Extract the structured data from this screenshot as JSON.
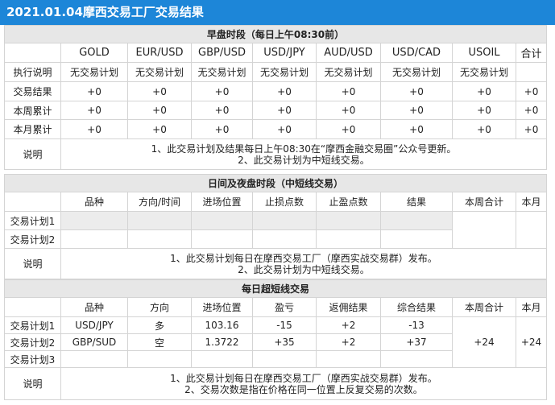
{
  "title": "2021.01.04摩西交易工厂交易结果",
  "s1": {
    "header": "早盘时段（每日上午08:30前）",
    "cols": [
      "GOLD",
      "EUR/USD",
      "GBP/USD",
      "USD/JPY",
      "AUD/USD",
      "USD/CAD",
      "USOIL",
      "合计"
    ],
    "rows": [
      {
        "label": "执行说明",
        "cells": [
          "无交易计划",
          "无交易计划",
          "无交易计划",
          "无交易计划",
          "无交易计划",
          "无交易计划",
          "无交易计划",
          ""
        ]
      },
      {
        "label": "交易结果",
        "cells": [
          "+0",
          "+0",
          "+0",
          "+0",
          "+0",
          "+0",
          "+0",
          "+0"
        ]
      },
      {
        "label": "本周累计",
        "cells": [
          "+0",
          "+0",
          "+0",
          "+0",
          "+0",
          "+0",
          "+0",
          "+0"
        ]
      },
      {
        "label": "本月累计",
        "cells": [
          "+0",
          "+0",
          "+0",
          "+0",
          "+0",
          "+0",
          "+0",
          "+0"
        ]
      }
    ],
    "note_label": "说明",
    "notes": [
      "1、此交易计划及结果每日上午08:30在“摩西金融交易圈”公众号更新。",
      "2、此交易计划为中短线交易。"
    ]
  },
  "s2": {
    "header": "日间及夜盘时段（中短线交易）",
    "cols": [
      "品种",
      "方向/时间",
      "进场位置",
      "止损点数",
      "止盈点数",
      "结果",
      "本周合计",
      "本月"
    ],
    "plans": [
      "交易计划1",
      "交易计划2"
    ],
    "note_label": "说明",
    "notes": [
      "1、此交易计划每日在摩西交易工厂（摩西实战交易群）发布。",
      "2、此交易计划为中短线交易。"
    ]
  },
  "s3": {
    "header": "每日超短线交易",
    "cols": [
      "品种",
      "方向",
      "进场位置",
      "盈亏",
      "返佣结果",
      "综合结果",
      "本周合计",
      "本月"
    ],
    "rows": [
      {
        "label": "交易计划1",
        "cells": [
          "USD/JPY",
          "多",
          "103.16",
          "-15",
          "+2",
          "-13"
        ]
      },
      {
        "label": "交易计划2",
        "cells": [
          "GBP/SUD",
          "空",
          "1.3722",
          "+35",
          "+2",
          "+37"
        ]
      },
      {
        "label": "交易计划3",
        "cells": [
          "",
          "",
          "",
          "",
          "",
          ""
        ]
      }
    ],
    "week_total": "+24",
    "month_total": "+24",
    "note_label": "说明",
    "notes": [
      "1、此交易计划每日在摩西交易工厂（摩西实战交易群）发布。",
      "2、交易次数是指在价格在同一位置上反复交易的次数。"
    ]
  }
}
